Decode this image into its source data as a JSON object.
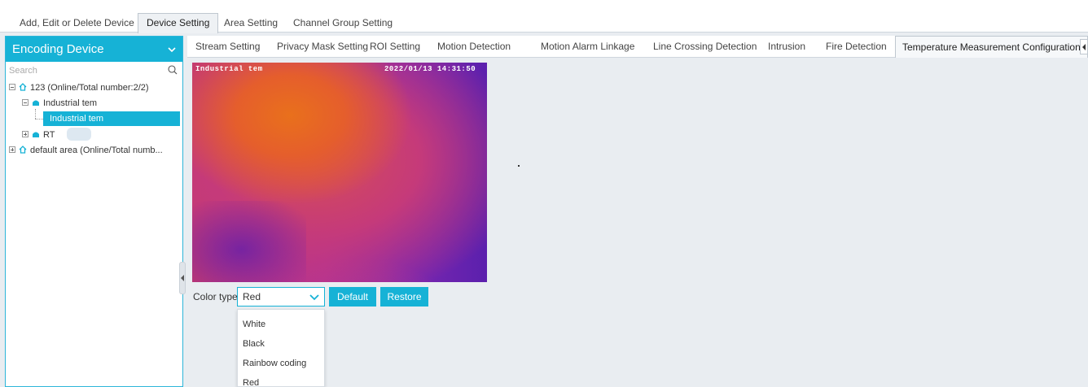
{
  "top_tabs": [
    {
      "label": "Add, Edit or Delete Device"
    },
    {
      "label": "Device Setting"
    },
    {
      "label": "Area Setting"
    },
    {
      "label": "Channel Group Setting"
    }
  ],
  "left_panel": {
    "title": "Encoding Device",
    "search_placeholder": "Search",
    "tree": {
      "area_123": "123 (Online/Total number:2/2)",
      "device_industrial": "Industrial tem",
      "channel_selected": "Industrial tem",
      "device_rt": "RT",
      "area_default": "default area (Online/Total numb..."
    }
  },
  "sub_tabs": [
    {
      "label": "Stream Setting"
    },
    {
      "label": "Privacy Mask Setting"
    },
    {
      "label": "ROI Setting"
    },
    {
      "label": "Motion Detection"
    },
    {
      "label": "Motion Alarm Linkage"
    },
    {
      "label": "Line Crossing Detection"
    },
    {
      "label": "Intrusion"
    },
    {
      "label": "Fire Detection"
    },
    {
      "label": "Temperature Measurement Configuration"
    }
  ],
  "video": {
    "osd_name": "Industrial tem",
    "osd_time": "2022/01/13 14:31:50"
  },
  "color_type": {
    "label": "Color type",
    "selected": "Red",
    "options": [
      "White",
      "Black",
      "Rainbow coding",
      "Red"
    ]
  },
  "buttons": {
    "default": "Default",
    "restore": "Restore"
  },
  "colors": {
    "accent": "#16b2d6",
    "background": "#e9edf1"
  }
}
